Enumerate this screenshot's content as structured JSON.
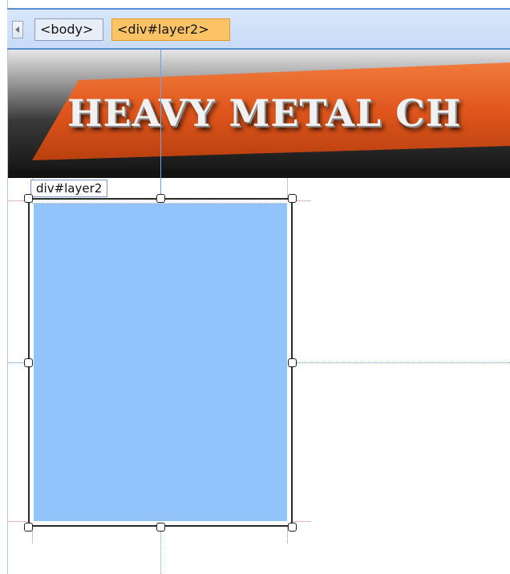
{
  "tag_selector": {
    "scroll_icon": "chevron-left-icon",
    "tags": [
      "<body>",
      "<div#layer2>"
    ]
  },
  "banner": {
    "title": "HEAVY METAL CH",
    "accent_color": "#e0561c"
  },
  "canvas": {
    "layer_label": "div#layer2",
    "layer_fill_color": "#93c3fb"
  }
}
